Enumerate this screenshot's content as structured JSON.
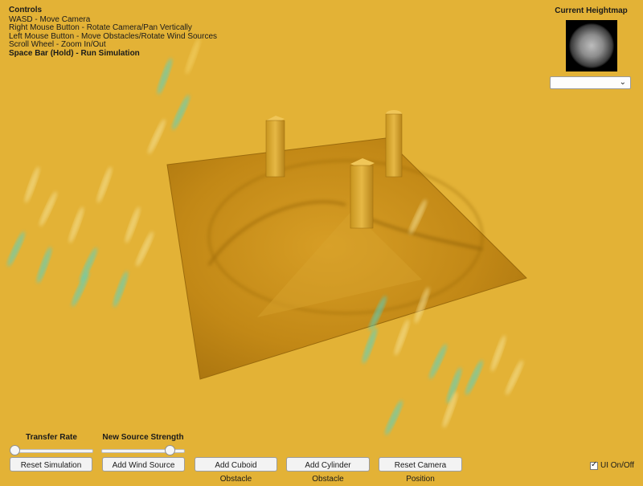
{
  "controls": {
    "title": "Controls",
    "lines": [
      "WASD - Move Camera",
      "Right Mouse Button - Rotate Camera/Pan Vertically",
      "Left Mouse Button - Move Obstacles/Rotate Wind Sources",
      "Scroll Wheel - Zoom In/Out",
      "Space Bar (Hold) - Run Simulation"
    ]
  },
  "heightmap": {
    "title": "Current Heightmap",
    "selected": ""
  },
  "sliders": {
    "transfer_rate": {
      "label": "Transfer Rate",
      "value": 0.0
    },
    "new_source_strength": {
      "label": "New Source Strength",
      "value": 0.85
    }
  },
  "buttons": {
    "reset_simulation": "Reset Simulation",
    "add_wind_source": "Add Wind Source",
    "add_cuboid_obstacle": "Add Cuboid Obstacle",
    "add_cylinder_obstacle": "Add Cylinder Obstacle",
    "reset_camera_position": "Reset Camera Position"
  },
  "ui_toggle": {
    "label": "UI On/Off",
    "checked": true
  },
  "colors": {
    "background": "#e3b236",
    "sand": "#c8901a",
    "wind_particle": "#49d6d2"
  }
}
